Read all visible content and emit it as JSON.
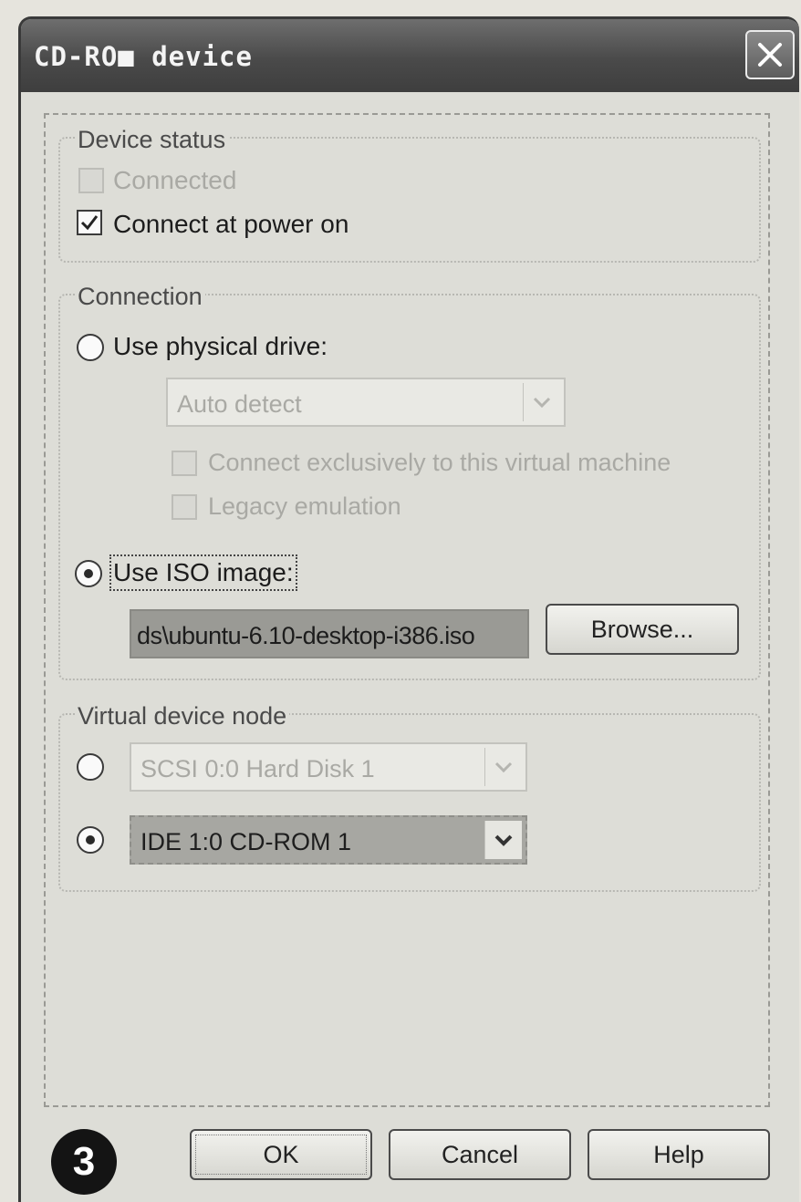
{
  "window": {
    "title": "CD-RO■ device"
  },
  "device_status": {
    "group_label": "Device status",
    "connected_label": "Connected",
    "connected_checked": false,
    "connected_enabled": false,
    "power_on_label": "Connect at power on",
    "power_on_checked": true
  },
  "connection": {
    "group_label": "Connection",
    "physical_label": "Use physical drive:",
    "physical_selected": false,
    "drive_select_value": "Auto detect",
    "exclusive_label": "Connect exclusively to this virtual machine",
    "legacy_label": "Legacy emulation",
    "iso_label": "Use ISO image:",
    "iso_selected": true,
    "iso_path": "ds\\ubuntu-6.10-desktop-i386.iso",
    "browse_label": "Browse..."
  },
  "virtual_node": {
    "group_label": "Virtual device node",
    "scsi_value": "SCSI 0:0  Hard Disk 1",
    "scsi_selected": false,
    "ide_value": "IDE 1:0  CD-ROM 1",
    "ide_selected": true
  },
  "footer": {
    "step_badge": "3",
    "ok_label": "OK",
    "cancel_label": "Cancel",
    "help_label": "Help"
  },
  "icons": {
    "close": "close-icon",
    "check": "checkmark-icon",
    "dropdown": "chevron-down-icon"
  }
}
